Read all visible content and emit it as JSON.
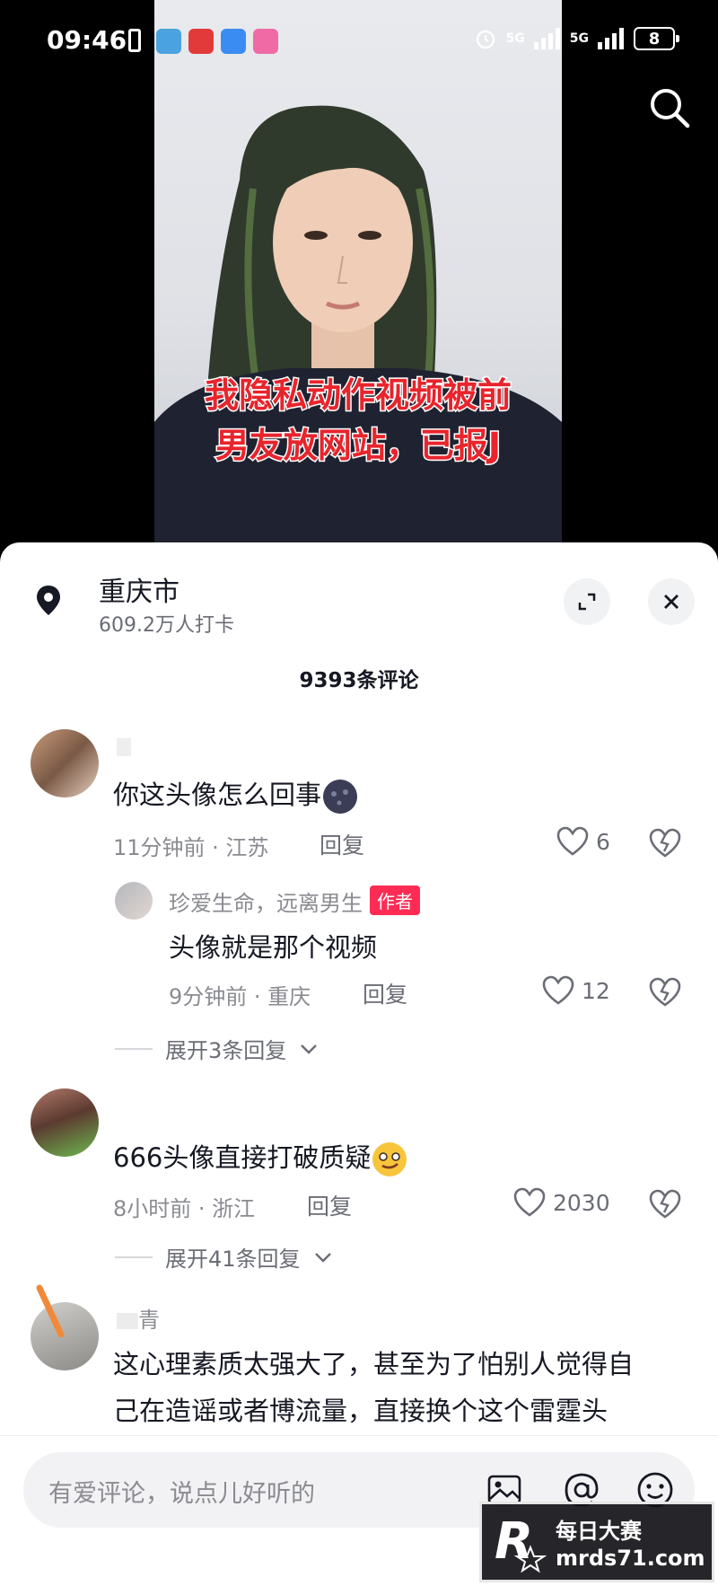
{
  "status_bar": {
    "time": "09:46",
    "network_1": "5G",
    "network_2": "5G",
    "battery": "8"
  },
  "video": {
    "caption": "我隐私动作视频被前男友放网站，已报J"
  },
  "location": {
    "name": "重庆市",
    "checkins": "609.2万人打卡"
  },
  "comments_header": "9393条评论",
  "comments": [
    {
      "text": "你这头像怎么回事",
      "time_location": "11分钟前 · 江苏",
      "reply_label": "回复",
      "likes": "6",
      "replies": [
        {
          "user": "珍爱生命，远离男生",
          "badge": "作者",
          "text": "头像就是那个视频",
          "time_location": "9分钟前 · 重庆",
          "reply_label": "回复",
          "likes": "12"
        }
      ],
      "expand": "展开3条回复"
    },
    {
      "text": "666头像直接打破质疑",
      "time_location": "8小时前 · 浙江",
      "reply_label": "回复",
      "likes": "2030",
      "expand": "展开41条回复"
    },
    {
      "user_partial": "青",
      "text_line1": "这心理素质太强大了，甚至为了怕别人觉得自",
      "text_line2": "己在造谣或者博流量，直接换个这个雷霆头"
    }
  ],
  "input": {
    "placeholder": "有爱评论，说点儿好听的"
  },
  "watermark": {
    "line1": "每日大赛",
    "line2": "mrds71.com"
  },
  "icons": [
    "search-icon",
    "location-pin-icon",
    "expand-icon",
    "close-icon",
    "heart-icon",
    "dislike-icon",
    "chevron-down-icon",
    "image-icon",
    "at-icon",
    "emoji-icon"
  ],
  "colors": {
    "caption_red": "#e8242c",
    "author_badge": "#fe2c55",
    "panel_bg": "#ffffff"
  }
}
